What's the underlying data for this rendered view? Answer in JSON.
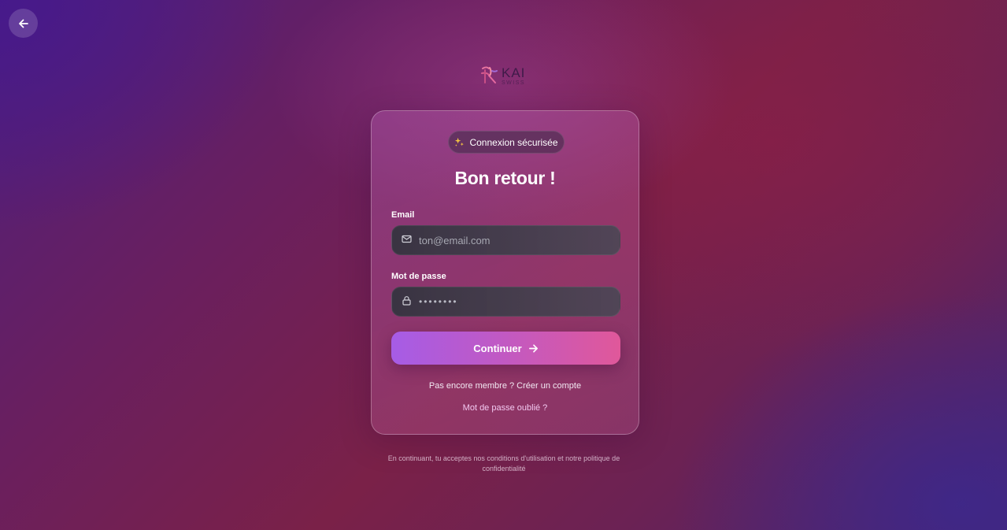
{
  "header": {
    "back_icon": "arrow-left-icon",
    "logo": {
      "name": "KAI",
      "tagline": "SWISS"
    }
  },
  "card": {
    "badge": {
      "icon": "sparkles-icon",
      "label": "Connexion sécurisée"
    },
    "title": "Bon retour !",
    "email": {
      "label": "Email",
      "icon": "mail-icon",
      "placeholder": "ton@email.com",
      "value": ""
    },
    "password": {
      "label": "Mot de passe",
      "icon": "lock-icon",
      "value": "••••••••"
    },
    "submit": {
      "label": "Continuer",
      "icon": "arrow-right-icon"
    },
    "signup": {
      "prompt": "Pas encore membre ?",
      "link": "Créer un compte"
    },
    "forgot": "Mot de passe oublié ?"
  },
  "footer": {
    "terms": "En continuant, tu acceptes nos conditions d'utilisation et notre politique de confidentialité"
  },
  "colors": {
    "button_start": "#a65ce6",
    "button_end": "#e0589a",
    "link_pink": "#f3c8f0",
    "field_bg": "#32343e"
  }
}
